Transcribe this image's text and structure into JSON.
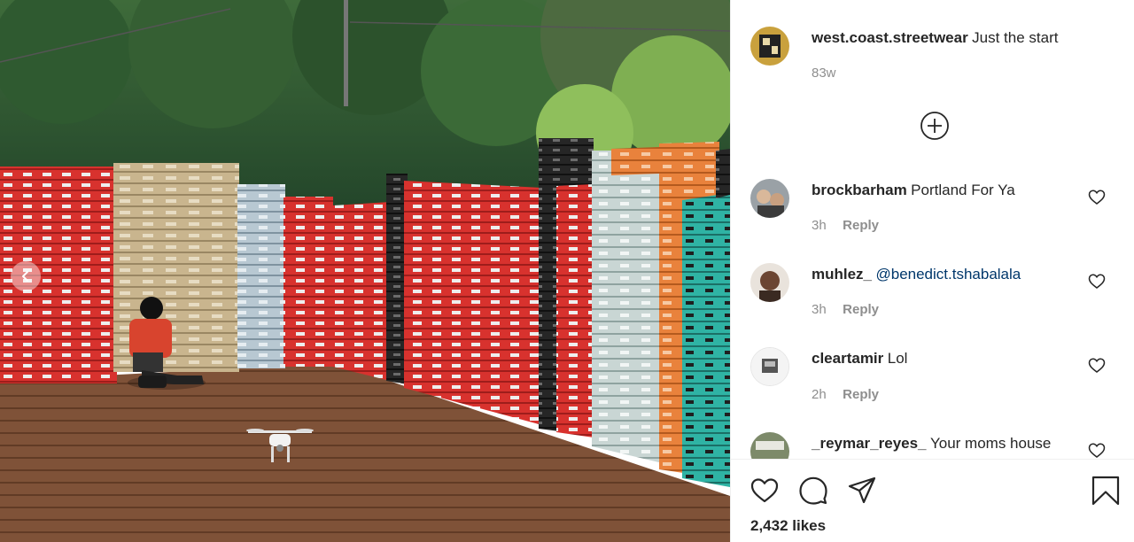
{
  "post": {
    "username": "west.coast.streetwear",
    "caption": "Just the start",
    "time": "83w",
    "likes": "2,432 likes"
  },
  "comments": [
    {
      "username": "brockbarham",
      "text": "Portland For Ya",
      "mention": "",
      "time": "3h",
      "reply": "Reply"
    },
    {
      "username": "muhlez_",
      "text": "",
      "mention": "@benedict.tshabalala",
      "time": "3h",
      "reply": "Reply"
    },
    {
      "username": "cleartamir",
      "text": "Lol",
      "mention": "",
      "time": "2h",
      "reply": "Reply"
    },
    {
      "username": "_reymar_reyes_",
      "text": "Your moms house",
      "mention": "",
      "time": "",
      "reply": ""
    }
  ],
  "icons": {
    "like": "heart-icon",
    "comment": "speech-bubble-icon",
    "share": "paper-plane-icon",
    "save": "bookmark-icon",
    "load_more": "plus-circle-icon",
    "prev": "chevron-left-icon"
  },
  "colors": {
    "text": "#262626",
    "secondary": "#8e8e8e",
    "mention": "#00376b",
    "divider": "#efefef"
  }
}
